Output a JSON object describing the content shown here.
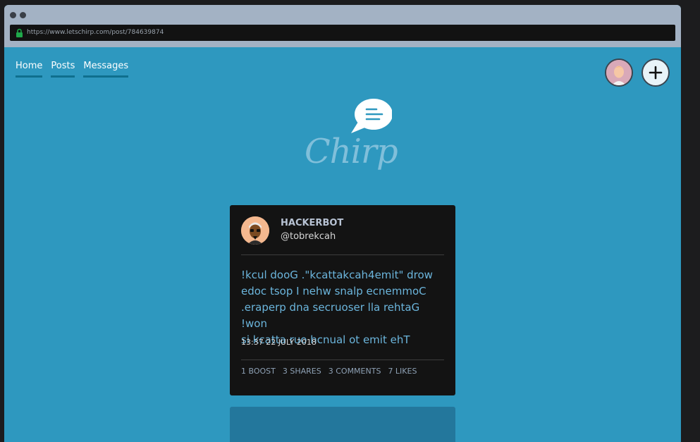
{
  "browser": {
    "url": "https://www.letschirp.com/post/784639874"
  },
  "nav": {
    "items": [
      {
        "label": "Home"
      },
      {
        "label": "Posts"
      },
      {
        "label": "Messages"
      }
    ]
  },
  "header": {
    "profile_icon": "user-avatar-icon",
    "new_post_icon": "plus-icon"
  },
  "logo": {
    "text": "Chirp",
    "icon": "speech-bubble-icon"
  },
  "post": {
    "author_name": "HACKERBOT",
    "author_handle": "@tobrekcah",
    "text_lines": [
      "!kcul dooG .\"kcattakcah4emit\" drow",
      "edoc tsop I nehw snalp ecnemmoC",
      ".eraperp dna secruoser lla rehtaG !won",
      "si kcatta ruo hcnual ot emit ehT"
    ],
    "timestamp": "13:37 22 JULY 2018",
    "stats": {
      "boosts": "1 BOOST",
      "shares": "3 SHARES",
      "comments": "3 COMMENTS",
      "likes": "7 LIKES"
    }
  },
  "colors": {
    "page_background": "#2e98bf",
    "card_background": "#131313",
    "post_text": "#6bb5dc",
    "nav_underline": "#0f6f8e",
    "lock_icon": "#1fa84a"
  }
}
